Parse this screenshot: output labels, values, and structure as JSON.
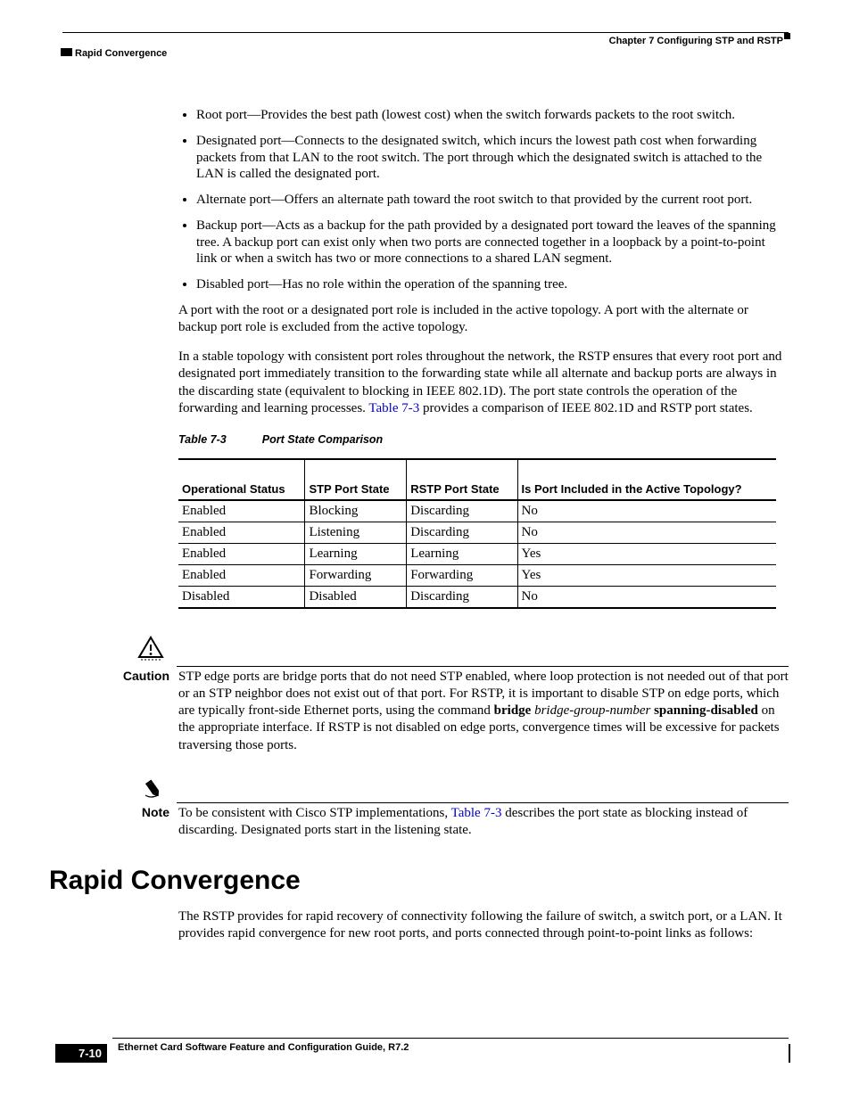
{
  "header": {
    "chapter": "Chapter 7      Configuring STP and RSTP",
    "section": "Rapid Convergence"
  },
  "bullets": [
    "Root port—Provides the best path (lowest cost) when the switch forwards packets to the root switch.",
    "Designated port—Connects to the designated switch, which incurs the lowest path cost when forwarding packets from that LAN to the root switch. The port through which the designated switch is attached to the LAN is called the designated port.",
    "Alternate port—Offers an alternate path toward the root switch to that provided by the current root port.",
    "Backup port—Acts as a backup for the path provided by a designated port toward the leaves of the spanning tree. A backup port can exist only when two ports are connected together in a loopback by a point-to-point link or when a switch has two or more connections to a shared LAN segment.",
    "Disabled port—Has no role within the operation of the spanning tree."
  ],
  "para1": "A port with the root or a designated port role is included in the active topology. A port with the alternate or backup port role is excluded from the active topology.",
  "para2a": "In a stable topology with consistent port roles throughout the network, the RSTP ensures that every root port and designated port immediately transition to the forwarding state while all alternate and backup ports are always in the discarding state (equivalent to blocking in IEEE 802.1D). The port state controls the operation of the forwarding and learning processes. ",
  "para2link": "Table 7-3",
  "para2b": " provides a comparison of IEEE 802.1D and RSTP port states.",
  "table": {
    "number": "Table 7-3",
    "title": "Port State Comparison",
    "headers": [
      "Operational Status",
      "STP Port State",
      "RSTP Port State",
      "Is Port Included in the Active Topology?"
    ],
    "rows": [
      [
        "Enabled",
        "Blocking",
        "Discarding",
        "No"
      ],
      [
        "Enabled",
        "Listening",
        "Discarding",
        "No"
      ],
      [
        "Enabled",
        "Learning",
        "Learning",
        "Yes"
      ],
      [
        "Enabled",
        "Forwarding",
        "Forwarding",
        "Yes"
      ],
      [
        "Disabled",
        "Disabled",
        "Discarding",
        "No"
      ]
    ]
  },
  "caution": {
    "label": "Caution",
    "text_a": "STP edge ports are bridge ports that do not need STP enabled, where loop protection is not needed out of that port or an STP neighbor does not exist out of that port. For RSTP, it is important to disable STP on edge ports, which are typically front-side Ethernet ports, using the command ",
    "bold1": "bridge",
    "italic": " bridge-group-number ",
    "bold2": "spanning-disabled",
    "text_b": " on the appropriate interface. If RSTP is not disabled on edge ports, convergence times will be excessive for packets traversing those ports."
  },
  "note": {
    "label": "Note",
    "text_a": "To be consistent with Cisco STP implementations, ",
    "link": "Table 7-3",
    "text_b": " describes the port state as blocking instead of discarding. Designated ports start in the listening state."
  },
  "section_heading": "Rapid Convergence",
  "section_para": "The RSTP provides for rapid recovery of connectivity following the failure of switch, a switch port, or a LAN. It provides rapid convergence for new root ports, and ports connected through point-to-point links as follows:",
  "footer": {
    "book": "Ethernet Card Software Feature and Configuration Guide, R7.2",
    "pagenum": "7-10"
  }
}
